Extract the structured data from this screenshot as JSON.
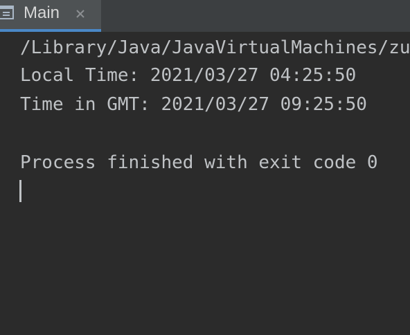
{
  "tab": {
    "label": "Main",
    "icon": "console-window-icon",
    "close_icon": "close-icon"
  },
  "console": {
    "lines": [
      "/Library/Java/JavaVirtualMachines/zu",
      "Local Time: 2021/03/27 04:25:50",
      "Time in GMT: 2021/03/27 09:25:50",
      "",
      "Process finished with exit code 0"
    ]
  },
  "colors": {
    "background": "#2b2b2b",
    "tab_bar": "#3c3f41",
    "active_tab": "#4e5254",
    "accent": "#4a88c7",
    "text": "#bfc2c5"
  }
}
